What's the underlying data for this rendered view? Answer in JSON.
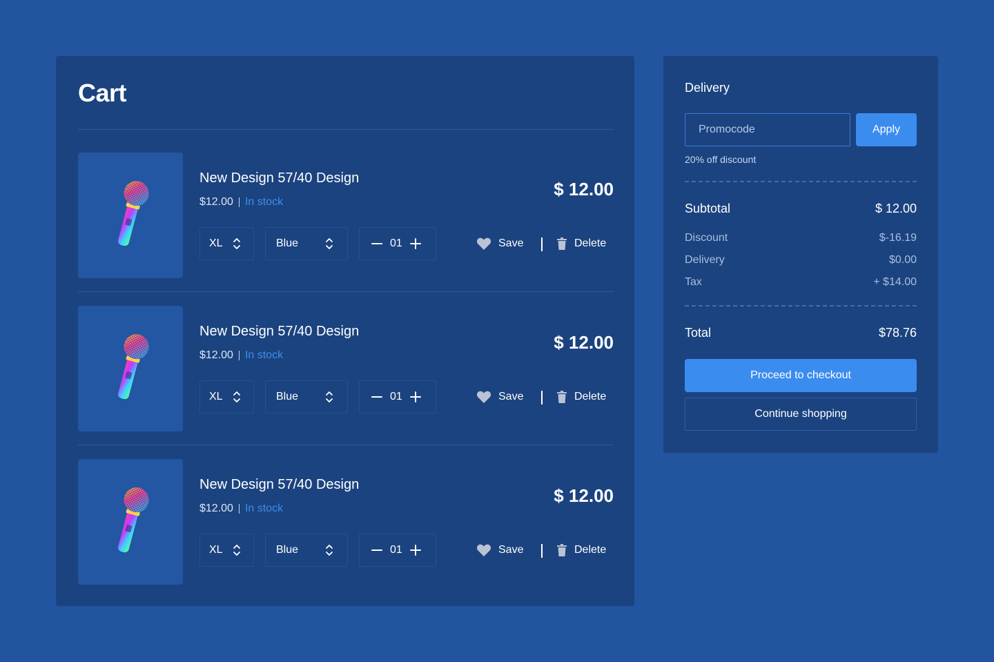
{
  "colors": {
    "page_bg": "#2354a0",
    "panel_bg": "#1b437f",
    "accent": "#3b8cef",
    "stock": "#3d8eec"
  },
  "cart": {
    "title": "Cart",
    "items": [
      {
        "name": "New Design 57/40 Design",
        "unit_price": "$12.00",
        "stock": "In stock",
        "price": "$ 12.00",
        "size": "XL",
        "color": "Blue",
        "qty": "01",
        "save_label": "Save",
        "delete_label": "Delete",
        "image": "microphone-image"
      },
      {
        "name": "New Design 57/40 Design",
        "unit_price": "$12.00",
        "stock": "In stock",
        "price": "$ 12.00",
        "size": "XL",
        "color": "Blue",
        "qty": "01",
        "save_label": "Save",
        "delete_label": "Delete",
        "image": "microphone-image"
      },
      {
        "name": "New Design 57/40 Design",
        "unit_price": "$12.00",
        "stock": "In stock",
        "price": "$ 12.00",
        "size": "XL",
        "color": "Blue",
        "qty": "01",
        "save_label": "Save",
        "delete_label": "Delete",
        "image": "microphone-image"
      }
    ]
  },
  "summary": {
    "title": "Delivery",
    "promo_placeholder": "Promocode",
    "apply_label": "Apply",
    "promo_note": "20% off discount",
    "subtotal_label": "Subtotal",
    "subtotal_value": "$ 12.00",
    "discount_label": "Discount",
    "discount_value": "$-16.19",
    "delivery_label": "Delivery",
    "delivery_value": "$0.00",
    "tax_label": "Tax",
    "tax_value": "+ $14.00",
    "total_label": "Total",
    "total_value": "$78.76",
    "checkout_label": "Proceed to checkout",
    "continue_label": "Continue shopping"
  }
}
